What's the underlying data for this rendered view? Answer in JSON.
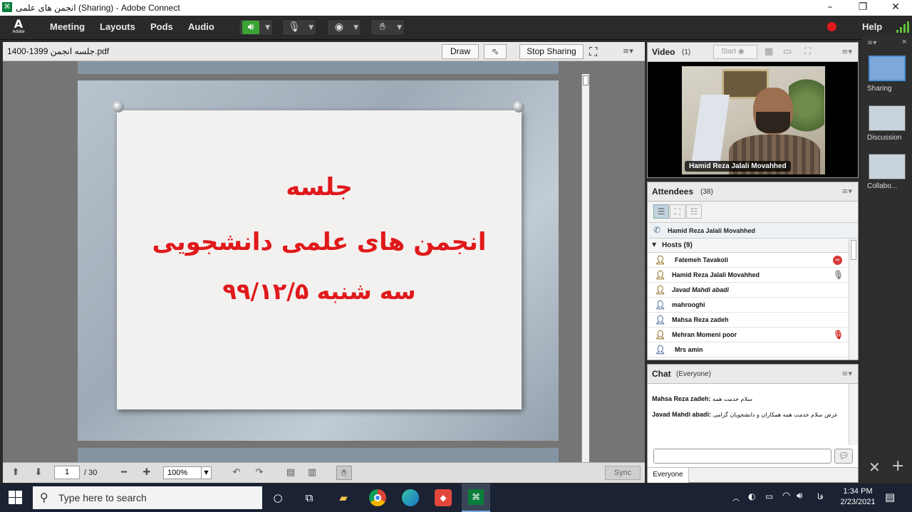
{
  "window": {
    "title": "انجمن های علمی (Sharing) - Adobe Connect",
    "app_icon": "adobe-connect-icon",
    "controls": {
      "minimize": "–",
      "maximize": "❐",
      "close": "✕"
    }
  },
  "menubar": {
    "logo": "Adobe",
    "items": [
      "Meeting",
      "Layouts",
      "Pods",
      "Audio"
    ],
    "help": "Help",
    "record_color": "#e0191b",
    "icons": [
      "speaker-icon",
      "microphone-icon",
      "webcam-icon",
      "raise-hand-icon"
    ]
  },
  "share": {
    "filename": "جلسه انجمن 1399-1400.pdf",
    "draw_label": "Draw",
    "stop_sharing_label": "Stop Sharing",
    "slide": {
      "line1": "جلسه",
      "line2": "انجمن های علمی دانشجویی",
      "line3": "سه شنبه ۹۹/۱۲/۵",
      "text_color": "#e0191b"
    },
    "footer": {
      "page_current": "1",
      "page_total": "/ 30",
      "zoom": "100%",
      "sync_label": "Sync"
    }
  },
  "video": {
    "title": "Video",
    "count": "(1)",
    "start_label": "Start",
    "presenter_name": "Hamid Reza Jalali Movahhed"
  },
  "attendees": {
    "title": "Attendees",
    "count": "(38)",
    "speaker": "Hamid Reza Jalali Movahhed",
    "group": "Hosts (9)",
    "rows": [
      {
        "name": "Fatemeh Tavakoli",
        "status_icon": "no-entry-icon"
      },
      {
        "name": "Hamid Reza Jalali Movahhed",
        "status_icon": "mic-active-icon"
      },
      {
        "name": "Javad Mahdi abadi",
        "status_icon": ""
      },
      {
        "name": "mahrooghi",
        "status_icon": ""
      },
      {
        "name": "Mahsa Reza zadeh",
        "status_icon": ""
      },
      {
        "name": "Mehran Momeni poor",
        "status_icon": "mic-muted-icon"
      },
      {
        "name": "Mrs amin",
        "status_icon": ""
      }
    ]
  },
  "chat": {
    "title": "Chat",
    "scope": "(Everyone)",
    "messages": [
      {
        "sender": "Mahsa Reza zadeh:",
        "text": "سلام خدمت همه"
      },
      {
        "sender": "Javad Mahdi abadi:",
        "text": "عرض سلام خدمت همه همکاران و دانشجویان گرامی"
      }
    ],
    "tab_label": "Everyone"
  },
  "layouts": {
    "items": [
      "Sharing",
      "Discussion",
      "Collabo..."
    ],
    "active": "Sharing"
  },
  "taskbar": {
    "search_placeholder": "Type here to search",
    "time": "1:34 PM",
    "date": "2/23/2021",
    "lang": "فا"
  }
}
